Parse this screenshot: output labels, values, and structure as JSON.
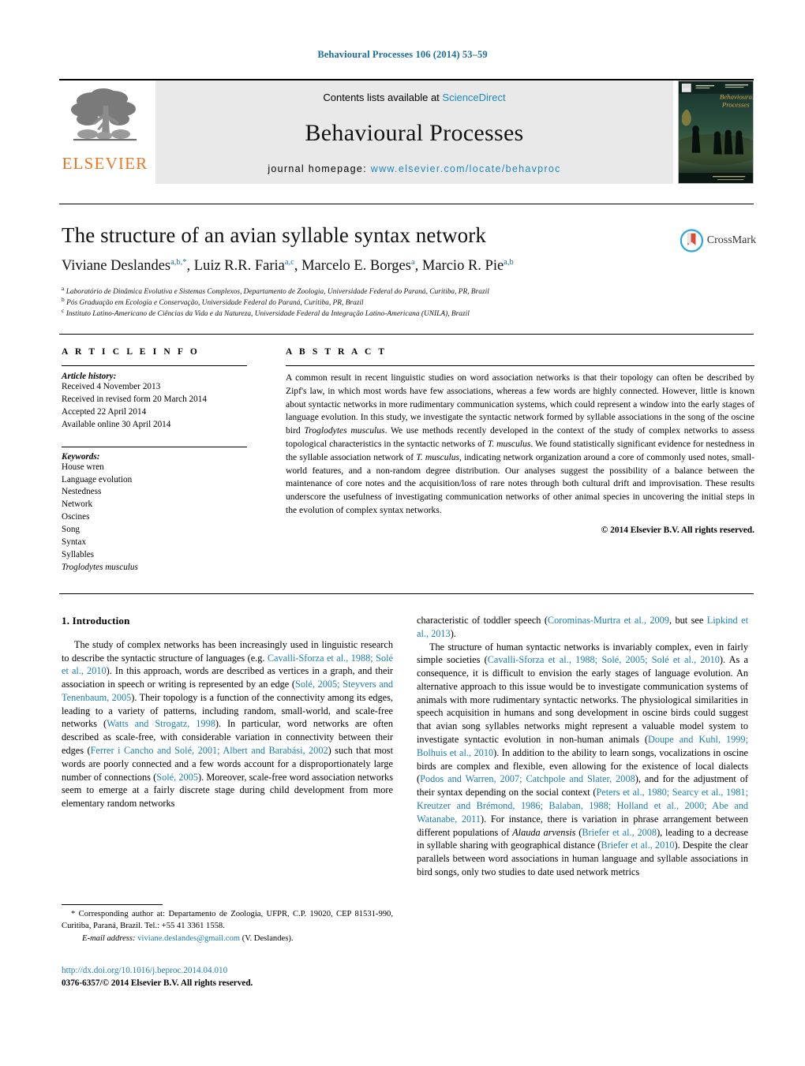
{
  "running_head": "Behavioural Processes 106 (2014) 53–59",
  "masthead": {
    "contents_prefix": "Contents lists available at ",
    "sciencedirect": "ScienceDirect",
    "journal_name": "Behavioural Processes",
    "homepage_label": "journal homepage:",
    "homepage_url": "www.elsevier.com/locate/behavproc",
    "elsevier_wordmark": "ELSEVIER",
    "cover_title_line1": "Behavioural",
    "cover_title_line2": "Processes",
    "colors": {
      "link_blue": "#1a8ac0",
      "elsevier_orange": "#E87722",
      "band_gray": "#e9e9e9"
    }
  },
  "article": {
    "title": "The structure of an avian syllable syntax network",
    "authors_html": "Viviane Deslandes<sup>a,b,*</sup>, Luiz R.R. Faria<sup>a,c</sup>, Marcelo E. Borges<sup>a</sup>, Marcio R. Pie<sup>a,b</sup>",
    "affiliations": [
      "Laboratório de Dinâmica Evolutiva e Sistemas Complexos, Departamento de Zoologia, Universidade Federal do Paraná, Curitiba, PR, Brazil",
      "Pós Graduação em Ecologia e Conservação, Universidade Federal do Paraná, Curitiba, PR, Brazil",
      "Instituto Latino-Americano de Ciências da Vida e da Natureza, Universidade Federal da Integração Latino-Americana (UNILA), Brazil"
    ],
    "affiliation_marks": [
      "a",
      "b",
      "c"
    ],
    "crossmark_label": "CrossMark"
  },
  "article_info": {
    "heading": "A R T I C L E    I N F O",
    "history_label": "Article history:",
    "history": [
      "Received 4 November 2013",
      "Received in revised form 20 March 2014",
      "Accepted 22 April 2014",
      "Available online 30 April 2014"
    ],
    "keywords_label": "Keywords:",
    "keywords": [
      "House wren",
      "Language evolution",
      "Nestedness",
      "Network",
      "Oscines",
      "Song",
      "Syntax",
      "Syllables"
    ],
    "keyword_italic": "Troglodytes musculus"
  },
  "abstract": {
    "heading": "A B S T R A C T",
    "paragraph_html": "A common result in recent linguistic studies on word association networks is that their topology can often be described by Zipf's law, in which most words have few associations, whereas a few words are highly connected. However, little is known about syntactic networks in more rudimentary communication systems, which could represent a window into the early stages of language evolution. In this study, we investigate the syntactic network formed by syllable associations in the song of the oscine bird <i>Troglodytes musculus</i>. We use methods recently developed in the context of the study of complex networks to assess topological characteristics in the syntactic networks of <i>T. musculus</i>. We found statistically significant evidence for nestedness in the syllable association network of <i>T. musculus</i>, indicating network organization around a core of commonly used notes, small-world features, and a non-random degree distribution. Our analyses suggest the possibility of a balance between the maintenance of core notes and the acquisition/loss of rare notes through both cultural drift and improvisation. These results underscore the usefulness of investigating communication networks of other animal species in uncovering the initial steps in the evolution of complex syntax networks.",
    "copyright": "© 2014 Elsevier B.V. All rights reserved."
  },
  "body": {
    "section_number_title": "1.  Introduction",
    "left_paragraph_html": "The study of complex networks has been increasingly used in linguistic research to describe the syntactic structure of languages (e.g. <span class=\"ref\">Cavalli-Sforza et al., 1988; Solé et al., 2010</span>). In this approach, words are described as vertices in a graph, and their association in speech or writing is represented by an edge (<span class=\"ref\">Solé, 2005; Steyvers and Tenenbaum, 2005</span>). Their topology is a function of the connectivity among its edges, leading to a variety of patterns, including random, small-world, and scale-free networks (<span class=\"ref\">Watts and Strogatz, 1998</span>). In particular, word networks are often described as scale-free, with considerable variation in connectivity between their edges (<span class=\"ref\">Ferrer i Cancho and Solé, 2001; Albert and Barabási, 2002</span>) such that most words are poorly connected and a few words account for a disproportionately large number of connections (<span class=\"ref\">Solé, 2005</span>). Moreover, scale-free word association networks seem to emerge at a fairly discrete stage during child development from more elementary random networks",
    "right_paragraph1_html": "characteristic of toddler speech (<span class=\"ref\">Corominas-Murtra et al., 2009</span>, but see <span class=\"ref\">Lipkind et al., 2013</span>).",
    "right_paragraph2_html": "The structure of human syntactic networks is invariably complex, even in fairly simple societies (<span class=\"ref\">Cavalli-Sforza et al., 1988; Solé, 2005; Solé et al., 2010</span>). As a consequence, it is difficult to envision the early stages of language evolution. An alternative approach to this issue would be to investigate communication systems of animals with more rudimentary syntactic networks. The physiological similarities in speech acquisition in humans and song development in oscine birds could suggest that avian song syllables networks might represent a valuable model system to investigate syntactic evolution in non-human animals (<span class=\"ref\">Doupe and Kuhl, 1999; Bolhuis et al., 2010</span>). In addition to the ability to learn songs, vocalizations in oscine birds are complex and flexible, even allowing for the existence of local dialects (<span class=\"ref\">Podos and Warren, 2007; Catchpole and Slater, 2008</span>), and for the adjustment of their syntax depending on the social context (<span class=\"ref\">Peters et al., 1980; Searcy et al., 1981; Kreutzer and Brémond, 1986; Balaban, 1988; Holland et al., 2000; Abe and Watanabe, 2011</span>). For instance, there is variation in phrase arrangement between different populations of <i>Alauda arvensis</i> (<span class=\"ref\">Briefer et al., 2008</span>), leading to a decrease in syllable sharing with geographical distance (<span class=\"ref\">Briefer et al., 2010</span>). Despite the clear parallels between word associations in human language and syllable associations in bird songs, only two studies to date used network metrics"
  },
  "footer": {
    "corresponding_html": "*  Corresponding author at: Departamento de Zoologia, UFPR, C.P. 19020, CEP 81531-990, Curitiba, Paraná, Brazil. Tel.: +55 41 3361 1558.",
    "email_label": "E-mail address:",
    "email": "viviane.deslandes@gmail.com",
    "email_suffix": "(V. Deslandes).",
    "doi": "http://dx.doi.org/10.1016/j.beproc.2014.04.010",
    "issn_line": "0376-6357/© 2014 Elsevier B.V. All rights reserved."
  }
}
